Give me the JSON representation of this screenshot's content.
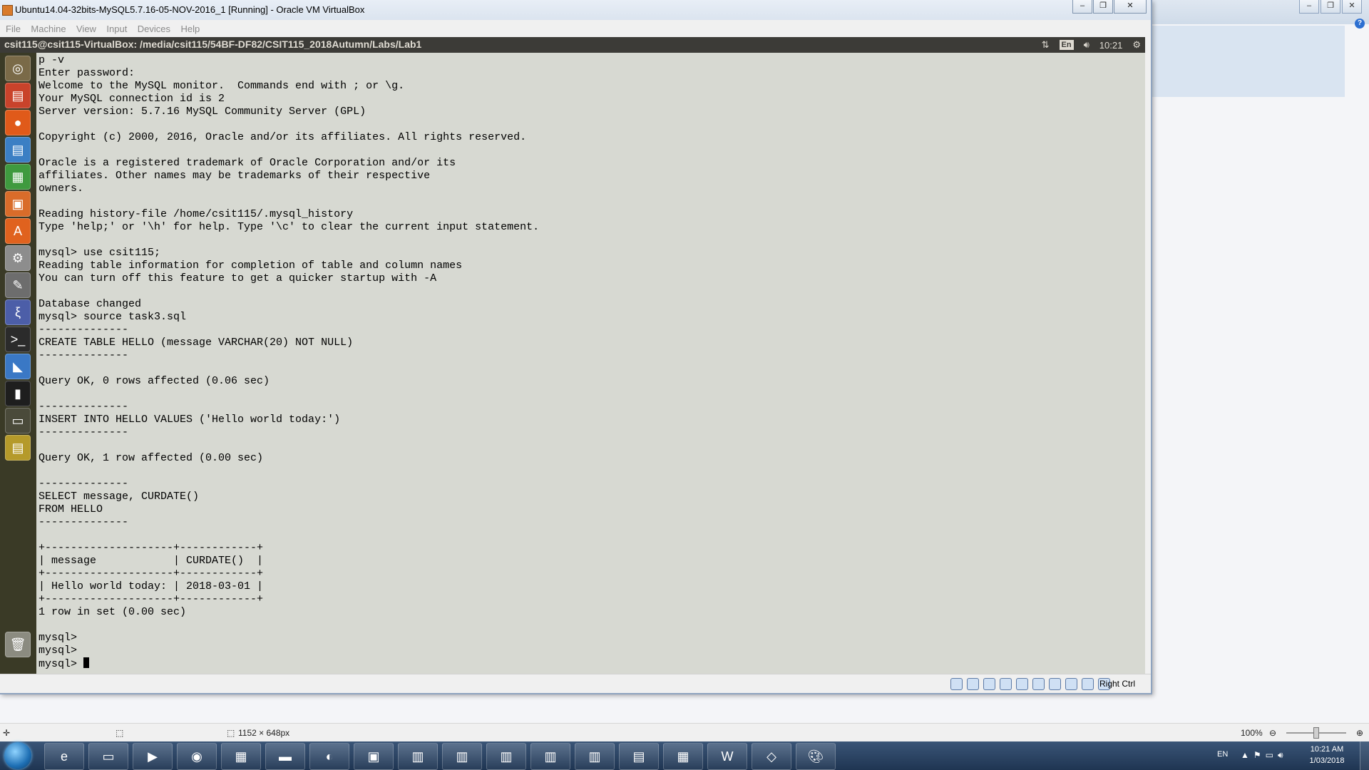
{
  "vbox": {
    "title": "Ubuntu14.04-32bits-MySQL5.7.16-05-NOV-2016_1 [Running] - Oracle VM VirtualBox",
    "menu": [
      "File",
      "Machine",
      "View",
      "Input",
      "Devices",
      "Help"
    ],
    "host_key": "Right Ctrl"
  },
  "ubuntu": {
    "terminal_title": "csit115@csit115-VirtualBox: /media/csit115/54BF-DF82/CSIT115_2018Autumn/Labs/Lab1",
    "lang": "En",
    "time": "10:21"
  },
  "terminal": {
    "lines": [
      "p -v",
      "Enter password:",
      "Welcome to the MySQL monitor.  Commands end with ; or \\g.",
      "Your MySQL connection id is 2",
      "Server version: 5.7.16 MySQL Community Server (GPL)",
      "",
      "Copyright (c) 2000, 2016, Oracle and/or its affiliates. All rights reserved.",
      "",
      "Oracle is a registered trademark of Oracle Corporation and/or its",
      "affiliates. Other names may be trademarks of their respective",
      "owners.",
      "",
      "Reading history-file /home/csit115/.mysql_history",
      "Type 'help;' or '\\h' for help. Type '\\c' to clear the current input statement.",
      "",
      "mysql> use csit115;",
      "Reading table information for completion of table and column names",
      "You can turn off this feature to get a quicker startup with -A",
      "",
      "Database changed",
      "mysql> source task3.sql",
      "--------------",
      "CREATE TABLE HELLO (message VARCHAR(20) NOT NULL)",
      "--------------",
      "",
      "Query OK, 0 rows affected (0.06 sec)",
      "",
      "--------------",
      "INSERT INTO HELLO VALUES ('Hello world today:')",
      "--------------",
      "",
      "Query OK, 1 row affected (0.00 sec)",
      "",
      "--------------",
      "SELECT message, CURDATE()",
      "FROM HELLO",
      "--------------",
      "",
      "+--------------------+------------+",
      "| message            | CURDATE()  |",
      "+--------------------+------------+",
      "| Hello world today: | 2018-03-01 |",
      "+--------------------+------------+",
      "1 row in set (0.00 sec)",
      "",
      "mysql>",
      "mysql>",
      "mysql> "
    ]
  },
  "host_status": {
    "dimensions": "1152 × 648px",
    "zoom": "100%",
    "zoom_level": 0.5
  },
  "taskbar": {
    "lang": "EN",
    "time": "10:21 AM",
    "date": "1/03/2018"
  }
}
